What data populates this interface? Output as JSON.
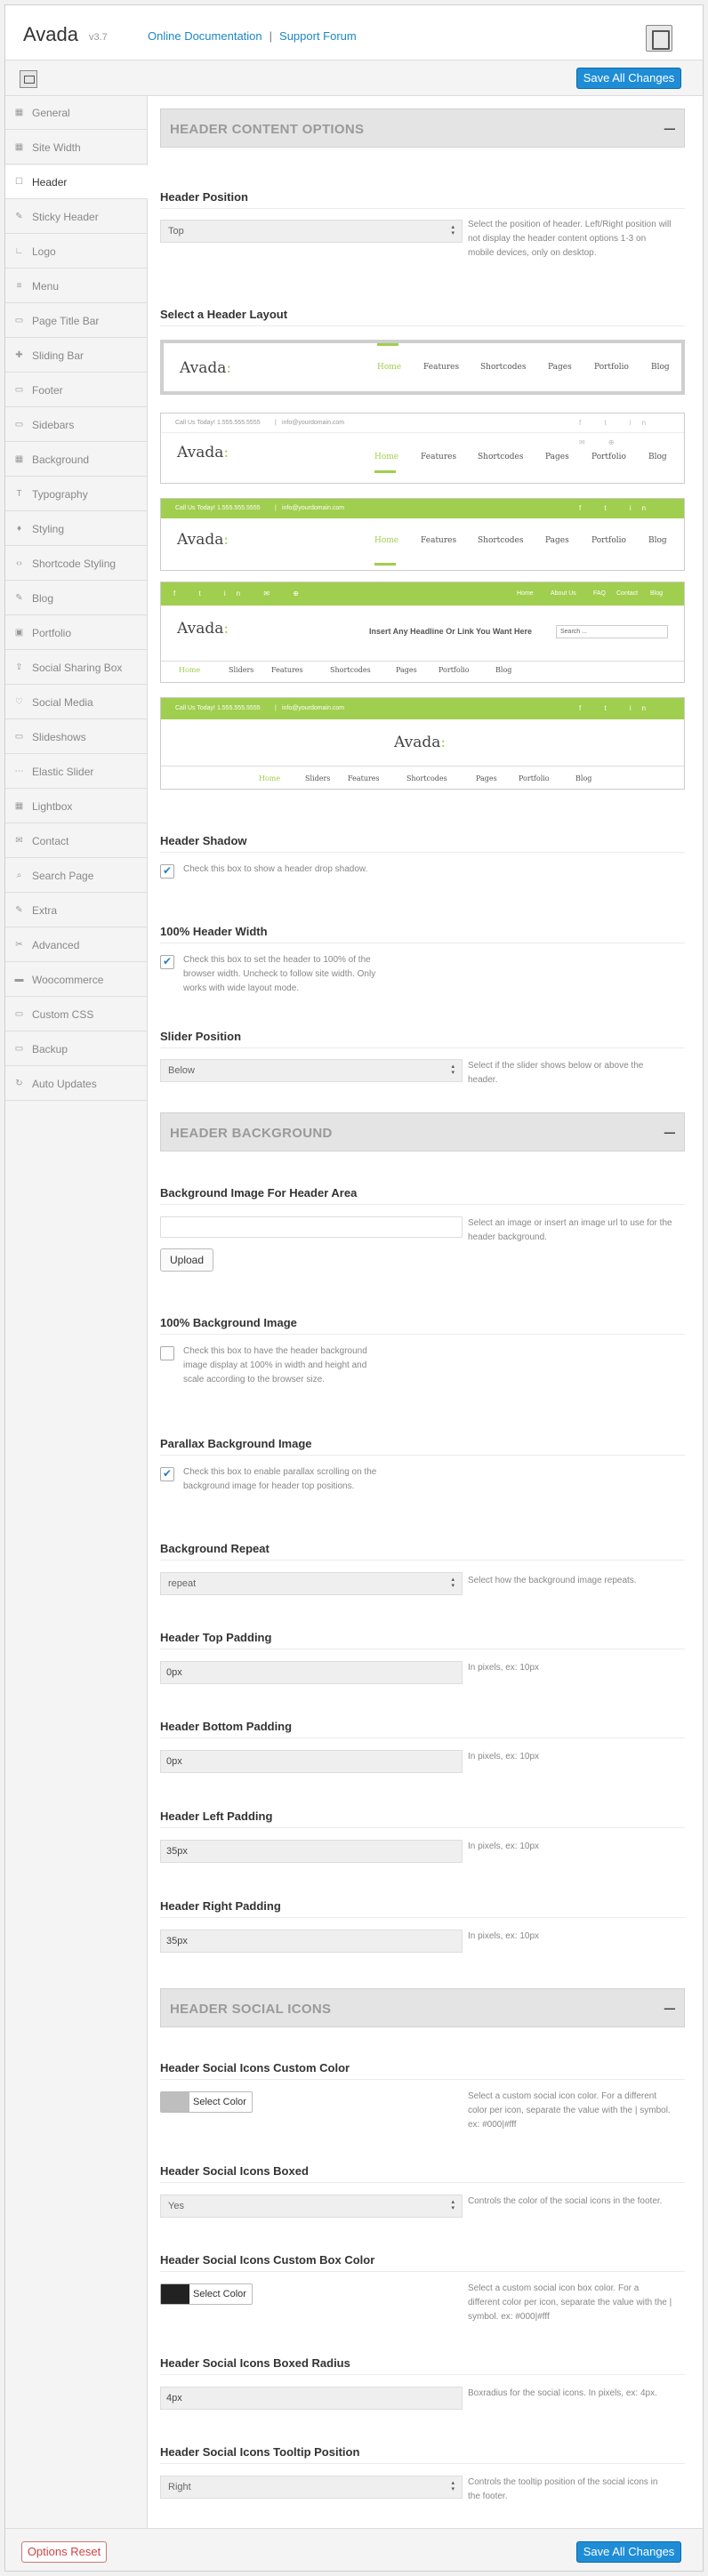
{
  "header": {
    "app_name": "Avada",
    "version": "v3.7",
    "doc_link": "Online Documentation",
    "separator": "|",
    "support_link": "Support Forum"
  },
  "toolbar": {
    "save_label": "Save All Changes"
  },
  "sidebar": {
    "items": [
      {
        "label": "General",
        "icon": "grid-icon",
        "glyph": "▦"
      },
      {
        "label": "Site Width",
        "icon": "grid-icon",
        "glyph": "▦"
      },
      {
        "label": "Header",
        "icon": "window-icon",
        "glyph": "☐"
      },
      {
        "label": "Sticky Header",
        "icon": "pin-icon",
        "glyph": "✎"
      },
      {
        "label": "Logo",
        "icon": "layout-icon",
        "glyph": "∟"
      },
      {
        "label": "Menu",
        "icon": "list-icon",
        "glyph": "≡"
      },
      {
        "label": "Page Title Bar",
        "icon": "image-icon",
        "glyph": "▭"
      },
      {
        "label": "Sliding Bar",
        "icon": "plus-icon",
        "glyph": "✚"
      },
      {
        "label": "Footer",
        "icon": "layout-icon",
        "glyph": "▭"
      },
      {
        "label": "Sidebars",
        "icon": "sidebar-icon",
        "glyph": "▭"
      },
      {
        "label": "Background",
        "icon": "image-icon",
        "glyph": "▦"
      },
      {
        "label": "Typography",
        "icon": "text-icon",
        "glyph": "T"
      },
      {
        "label": "Styling",
        "icon": "drop-icon",
        "glyph": "♦"
      },
      {
        "label": "Shortcode Styling",
        "icon": "code-icon",
        "glyph": "‹›"
      },
      {
        "label": "Blog",
        "icon": "book-icon",
        "glyph": "✎"
      },
      {
        "label": "Portfolio",
        "icon": "folder-icon",
        "glyph": "▣"
      },
      {
        "label": "Social Sharing Box",
        "icon": "share-icon",
        "glyph": "⇪"
      },
      {
        "label": "Social Media",
        "icon": "heart-icon",
        "glyph": "♡"
      },
      {
        "label": "Slideshows",
        "icon": "slides-icon",
        "glyph": "▭"
      },
      {
        "label": "Elastic Slider",
        "icon": "dots-icon",
        "glyph": "⋯"
      },
      {
        "label": "Lightbox",
        "icon": "lightbox-icon",
        "glyph": "▦"
      },
      {
        "label": "Contact",
        "icon": "mail-icon",
        "glyph": "✉"
      },
      {
        "label": "Search Page",
        "icon": "search-icon",
        "glyph": "⌕"
      },
      {
        "label": "Extra",
        "icon": "edit-icon",
        "glyph": "✎"
      },
      {
        "label": "Advanced",
        "icon": "wrench-icon",
        "glyph": "✂"
      },
      {
        "label": "Woocommerce",
        "icon": "cart-icon",
        "glyph": "▬"
      },
      {
        "label": "Custom CSS",
        "icon": "css-icon",
        "glyph": "▭"
      },
      {
        "label": "Backup",
        "icon": "backup-icon",
        "glyph": "▭"
      },
      {
        "label": "Auto Updates",
        "icon": "refresh-icon",
        "glyph": "↻"
      }
    ]
  },
  "sections": {
    "header_content": {
      "title": "HEADER CONTENT OPTIONS",
      "collapse": "–"
    },
    "header_background": {
      "title": "HEADER BACKGROUND",
      "collapse": "–"
    },
    "header_social": {
      "title": "HEADER SOCIAL ICONS",
      "collapse": "–"
    }
  },
  "fields": {
    "header_position": {
      "label": "Header Position",
      "value": "Top",
      "desc": "Select the position of header. Left/Right position will not display the header content options 1-3 on mobile devices, only on desktop."
    },
    "header_layout": {
      "label": "Select a Header Layout"
    },
    "header_shadow": {
      "label": "Header Shadow",
      "desc": "Check this box to show a header drop shadow.",
      "checked": true
    },
    "header_100": {
      "label": "100% Header Width",
      "desc": "Check this box to set the header to 100% of the browser width. Uncheck to follow site width. Only works with wide layout mode.",
      "checked": true
    },
    "slider_position": {
      "label": "Slider Position",
      "value": "Below",
      "desc": "Select if the slider shows below or above the header."
    },
    "bg_image": {
      "label": "Background Image For Header Area",
      "value": "",
      "upload": "Upload",
      "desc": "Select an image or insert an image url to use for the header background."
    },
    "bg_100": {
      "label": "100% Background Image",
      "desc": "Check this box to have the header background image display at 100% in width and height and scale according to the browser size.",
      "checked": false
    },
    "parallax": {
      "label": "Parallax Background Image",
      "desc": "Check this box to enable parallax scrolling on the background image for header top positions.",
      "checked": true
    },
    "bg_repeat": {
      "label": "Background Repeat",
      "value": "repeat",
      "desc": "Select how the background image repeats."
    },
    "top_padding": {
      "label": "Header Top Padding",
      "value": "0px",
      "desc": "In pixels, ex: 10px"
    },
    "bottom_padding": {
      "label": "Header Bottom Padding",
      "value": "0px",
      "desc": "In pixels, ex: 10px"
    },
    "left_padding": {
      "label": "Header Left Padding",
      "value": "35px",
      "desc": "In pixels, ex: 10px"
    },
    "right_padding": {
      "label": "Header Right Padding",
      "value": "35px",
      "desc": "In pixels, ex: 10px"
    },
    "social_color": {
      "label": "Header Social Icons Custom Color",
      "button": "Select Color",
      "color": "#bebebe",
      "desc": "Select a custom social icon color. For a different color per icon, separate the value with the | symbol. ex: #000|#fff"
    },
    "social_boxed": {
      "label": "Header Social Icons Boxed",
      "value": "Yes",
      "desc": "Controls the color of the social icons in the footer."
    },
    "social_box_color": {
      "label": "Header Social Icons Custom Box Color",
      "button": "Select Color",
      "color": "#222222",
      "desc": "Select a custom social icon box color. For a different color per icon, separate the value with the | symbol. ex: #000|#fff"
    },
    "social_radius": {
      "label": "Header Social Icons Boxed Radius",
      "value": "4px",
      "desc": "Boxradius for the social icons. In pixels, ex: 4px."
    },
    "social_tooltip": {
      "label": "Header Social Icons Tooltip Position",
      "value": "Right",
      "desc": "Controls the tooltip position of the social icons in the footer."
    }
  },
  "layouts": {
    "logo": "Avada",
    "logo_mark": ":",
    "menu": [
      "Home",
      "Features",
      "Shortcodes",
      "Pages",
      "Portfolio",
      "Blog"
    ],
    "menu_v4": [
      "Home",
      "About Us",
      "FAQ",
      "Contact",
      "Blog"
    ],
    "menu_v5": [
      "Home",
      "Sliders",
      "Features",
      "Shortcodes",
      "Pages",
      "Portfolio",
      "Blog"
    ],
    "contact": "Call Us Today! 1.555.555.5555",
    "email": "info@yourdomain.com",
    "headline": "Insert Any Headline Or Link You Want Here",
    "search": "Search ...",
    "social_glyphs": "f t in ✉ ⊕",
    "accent": "#a0ce4e"
  },
  "footer": {
    "reset_label": "Options Reset",
    "save_label": "Save All Changes"
  }
}
